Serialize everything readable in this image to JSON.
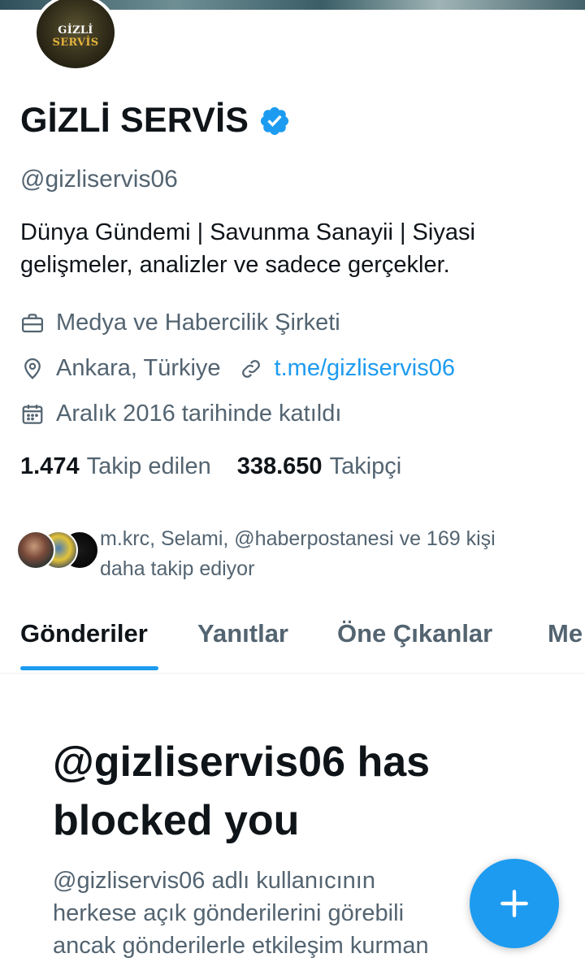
{
  "profile": {
    "avatar_text_1": "GİZLİ",
    "avatar_text_2": "SERVİS",
    "name": "GİZLİ SERVİS",
    "handle": "@gizliservis06",
    "bio_line1": "Dünya Gündemi | Savunma Sanayii | Siyasi",
    "bio_line2": "gelişmeler, analizler ve sadece gerçekler.",
    "category": "Medya ve Habercilik Şirketi",
    "location": "Ankara, Türkiye",
    "link": "t.me/gizliservis06",
    "joined": "Aralık 2016 tarihinde katıldı",
    "following_count": "1.474",
    "following_label": "Takip edilen",
    "followers_count": "338.650",
    "followers_label": "Takipçi",
    "known_followers_line1": "m.krc, Selami, @haberpostanesi ve 169 kişi",
    "known_followers_line2": "daha takip ediyor"
  },
  "icons": {
    "verified": "verified-badge-icon",
    "category": "briefcase-icon",
    "location": "location-pin-icon",
    "link": "link-icon",
    "joined": "calendar-icon",
    "compose": "plus-icon"
  },
  "tabs": [
    {
      "label": "Gönderiler",
      "active": true
    },
    {
      "label": "Yanıtlar",
      "active": false
    },
    {
      "label": "Öne Çıkanlar",
      "active": false
    },
    {
      "label": "Me",
      "active": false
    }
  ],
  "blocked": {
    "title_line1": "@gizliservis06 has",
    "title_line2": "blocked you",
    "desc_line1": "@gizliservis06 adlı kullanıcının",
    "desc_line2": "herkese açık gönderilerini görebili",
    "desc_line3": "ancak gönderilerle etkileşim kurman"
  },
  "colors": {
    "accent": "#1d9bf0",
    "text_primary": "#0f1419",
    "text_secondary": "#536471"
  }
}
